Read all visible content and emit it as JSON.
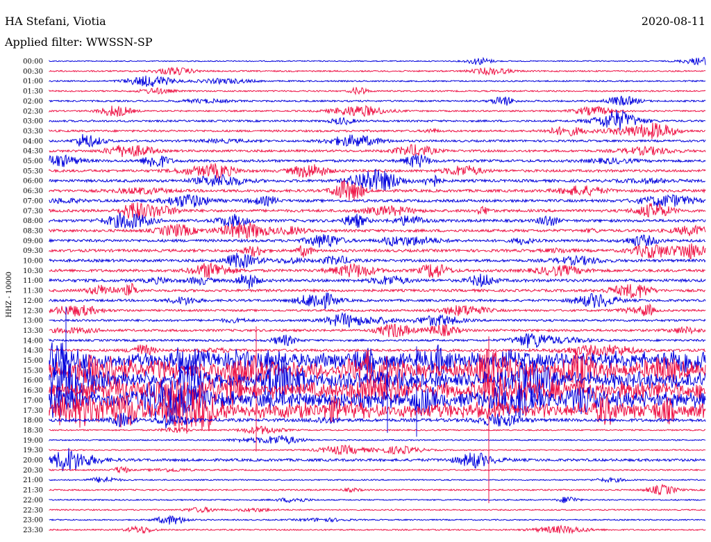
{
  "header": {
    "station": "HA Stefani, Viotia",
    "date": "2020-08-11",
    "filter": "Applied filter: WWSSN-SP"
  },
  "chart_data": {
    "type": "line",
    "title": "HA Stefani, Viotia",
    "ylabel": "HHZ - 10000",
    "colors": [
      "#0000dd",
      "#ee1144"
    ],
    "rows": [
      {
        "label": "00:00",
        "activity": 0.05
      },
      {
        "label": "00:30",
        "activity": 0.12
      },
      {
        "label": "01:00",
        "activity": 0.12
      },
      {
        "label": "01:30",
        "activity": 0.12
      },
      {
        "label": "02:00",
        "activity": 0.18
      },
      {
        "label": "02:30",
        "activity": 0.15
      },
      {
        "label": "03:00",
        "activity": 0.22
      },
      {
        "label": "03:30",
        "activity": 0.25
      },
      {
        "label": "04:00",
        "activity": 0.25
      },
      {
        "label": "04:30",
        "activity": 0.3
      },
      {
        "label": "05:00",
        "activity": 0.35
      },
      {
        "label": "05:30",
        "activity": 0.35
      },
      {
        "label": "06:00",
        "activity": 0.38
      },
      {
        "label": "06:30",
        "activity": 0.38
      },
      {
        "label": "07:00",
        "activity": 0.38
      },
      {
        "label": "07:30",
        "activity": 0.38
      },
      {
        "label": "08:00",
        "activity": 0.38
      },
      {
        "label": "08:30",
        "activity": 0.38
      },
      {
        "label": "09:00",
        "activity": 0.38
      },
      {
        "label": "09:30",
        "activity": 0.38
      },
      {
        "label": "10:00",
        "activity": 0.38
      },
      {
        "label": "10:30",
        "activity": 0.38
      },
      {
        "label": "11:00",
        "activity": 0.42
      },
      {
        "label": "11:30",
        "activity": 0.35
      },
      {
        "label": "12:00",
        "activity": 0.3
      },
      {
        "label": "12:30",
        "activity": 0.25
      },
      {
        "label": "13:00",
        "activity": 0.28
      },
      {
        "label": "13:30",
        "activity": 0.3
      },
      {
        "label": "14:00",
        "activity": 0.25
      },
      {
        "label": "14:30",
        "activity": 0.35
      },
      {
        "label": "15:00",
        "activity": 1.0
      },
      {
        "label": "15:30",
        "activity": 1.0
      },
      {
        "label": "16:00",
        "activity": 1.0
      },
      {
        "label": "16:30",
        "activity": 1.0
      },
      {
        "label": "17:00",
        "activity": 1.0
      },
      {
        "label": "17:30",
        "activity": 0.85
      },
      {
        "label": "18:00",
        "activity": 0.45
      },
      {
        "label": "18:30",
        "activity": 0.1
      },
      {
        "label": "19:00",
        "activity": 0.08
      },
      {
        "label": "19:30",
        "activity": 0.08
      },
      {
        "label": "20:00",
        "activity": 0.35
      },
      {
        "label": "20:30",
        "activity": 0.12
      },
      {
        "label": "21:00",
        "activity": 0.08
      },
      {
        "label": "21:30",
        "activity": 0.12
      },
      {
        "label": "22:00",
        "activity": 0.08
      },
      {
        "label": "22:30",
        "activity": 0.08
      },
      {
        "label": "23:00",
        "activity": 0.08
      },
      {
        "label": "23:30",
        "activity": 0.1
      }
    ]
  }
}
